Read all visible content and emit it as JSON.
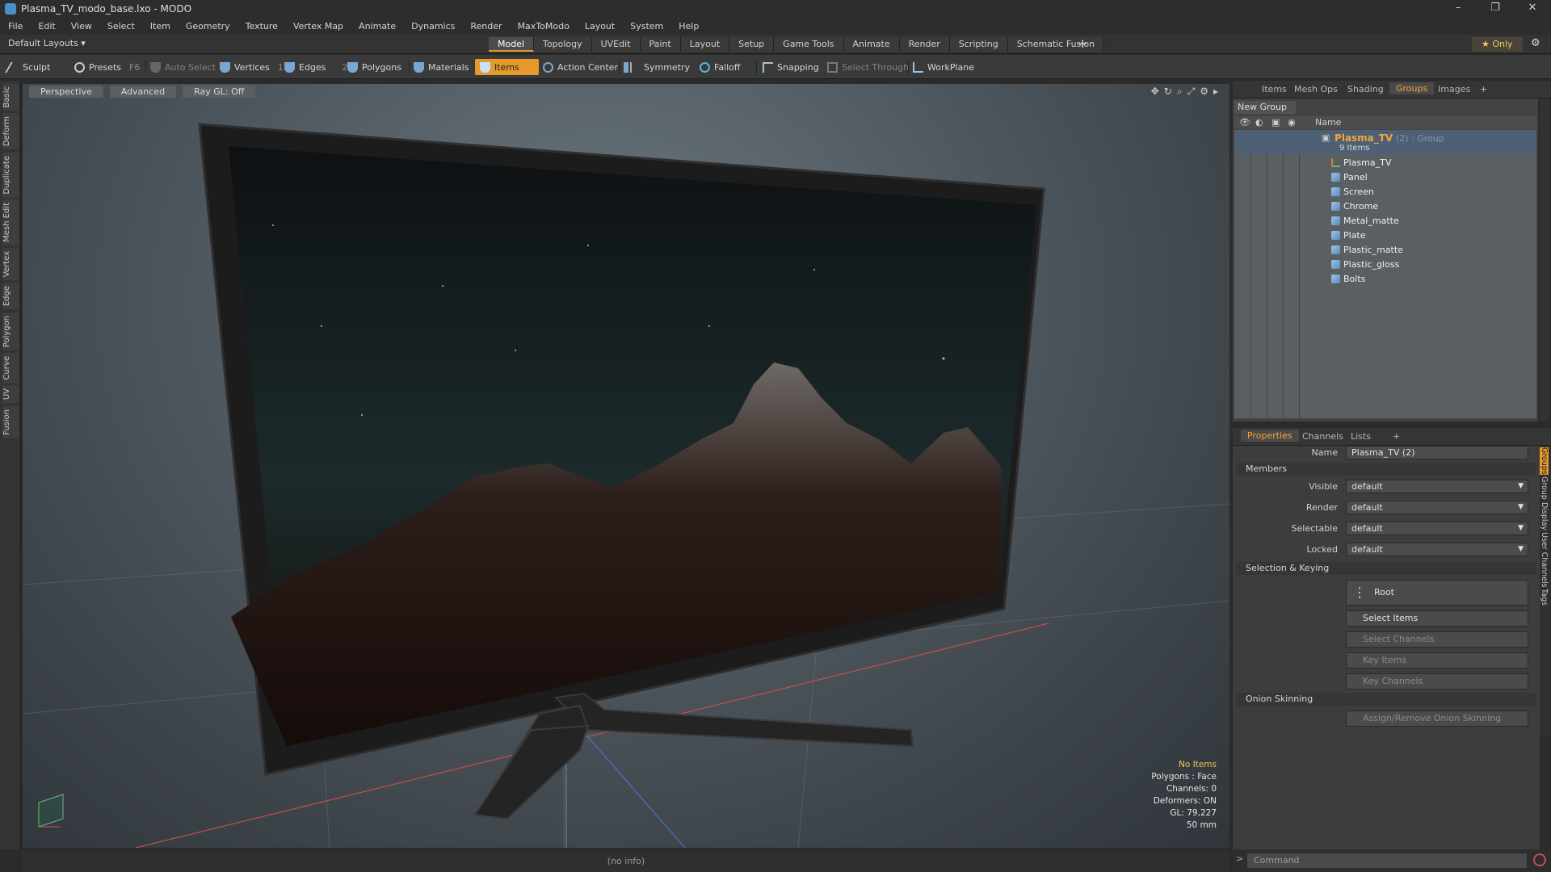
{
  "window": {
    "title": "Plasma_TV_modo_base.lxo - MODO",
    "controls": [
      "–",
      "❐",
      "✕"
    ]
  },
  "menu": [
    "File",
    "Edit",
    "View",
    "Select",
    "Item",
    "Geometry",
    "Texture",
    "Vertex Map",
    "Animate",
    "Dynamics",
    "Render",
    "MaxToModo",
    "Layout",
    "System",
    "Help"
  ],
  "layout_row": {
    "layouts_label": "Default Layouts ▾",
    "tabs": [
      {
        "label": "Model",
        "active": true
      },
      {
        "label": "Topology"
      },
      {
        "label": "UVEdit"
      },
      {
        "label": "Paint"
      },
      {
        "label": "Layout"
      },
      {
        "label": "Setup"
      },
      {
        "label": "Game Tools"
      },
      {
        "label": "Animate"
      },
      {
        "label": "Render"
      },
      {
        "label": "Scripting"
      },
      {
        "label": "Schematic Fusion"
      }
    ],
    "plus": "+",
    "only_label": "★ Only"
  },
  "toolbar": {
    "sculpt": "Sculpt",
    "presets": "Presets",
    "presets_key": "F6",
    "auto_select": "Auto Select",
    "vertices": "Vertices",
    "vertices_count": "1",
    "edges": "Edges",
    "edges_count": "2",
    "polygons": "Polygons",
    "materials": "Materials",
    "items": "Items",
    "action_center": "Action Center",
    "symmetry": "Symmetry",
    "falloff": "Falloff",
    "snapping": "Snapping",
    "select_through": "Select Through",
    "workplane": "WorkPlane"
  },
  "left_tabs": [
    "Basic",
    "Deform",
    "Duplicate",
    "Mesh Edit",
    "Vertex",
    "Edge",
    "Polygon",
    "Curve",
    "UV",
    "Fusion"
  ],
  "viewport": {
    "view_mode": "Perspective",
    "shading": "Advanced",
    "raygl": "Ray GL: Off",
    "stats": {
      "items": "No Items",
      "polygons": "Polygons : Face",
      "channels": "Channels: 0",
      "deformers": "Deformers: ON",
      "gl": "GL: 79,227",
      "focal": "50 mm"
    }
  },
  "status": "(no info)",
  "groups_panel": {
    "tabs": [
      {
        "label": "Items"
      },
      {
        "label": "Mesh Ops"
      },
      {
        "label": "Shading"
      },
      {
        "label": "Groups",
        "active": true
      },
      {
        "label": "Images"
      }
    ],
    "plus": "+",
    "new_group": "New Group",
    "name_header": "Name",
    "group": {
      "name": "Plasma_TV",
      "suffix": "(2) : Group",
      "count": "9 Items"
    },
    "children": [
      "Plasma_TV",
      "Panel",
      "Screen",
      "Chrome",
      "Metal_matte",
      "Plate",
      "Plastic_matte",
      "Plastic_gloss",
      "Bolts"
    ]
  },
  "properties_panel": {
    "tabs": [
      {
        "label": "Properties",
        "active": true
      },
      {
        "label": "Channels"
      },
      {
        "label": "Lists"
      }
    ],
    "plus": "+",
    "name_label": "Name",
    "name_value": "Plasma_TV (2)",
    "members_section": "Members",
    "members": [
      {
        "label": "Visible",
        "value": "default"
      },
      {
        "label": "Render",
        "value": "default"
      },
      {
        "label": "Selectable",
        "value": "default"
      },
      {
        "label": "Locked",
        "value": "default"
      }
    ],
    "selection_section": "Selection & Keying",
    "root_label": "Root",
    "select_items": "Select Items",
    "select_channels": "Select Channels",
    "key_items": "Key Items",
    "key_channels": "Key Channels",
    "onion_section": "Onion Skinning",
    "onion_button": "Assign/Remove Onion Skinning",
    "side_tabs": [
      {
        "label": "Groups",
        "active": true
      },
      {
        "label": "Group Display"
      },
      {
        "label": "User Channels"
      },
      {
        "label": "Tags"
      }
    ]
  },
  "command": {
    "prompt": ">",
    "placeholder": "Command"
  }
}
